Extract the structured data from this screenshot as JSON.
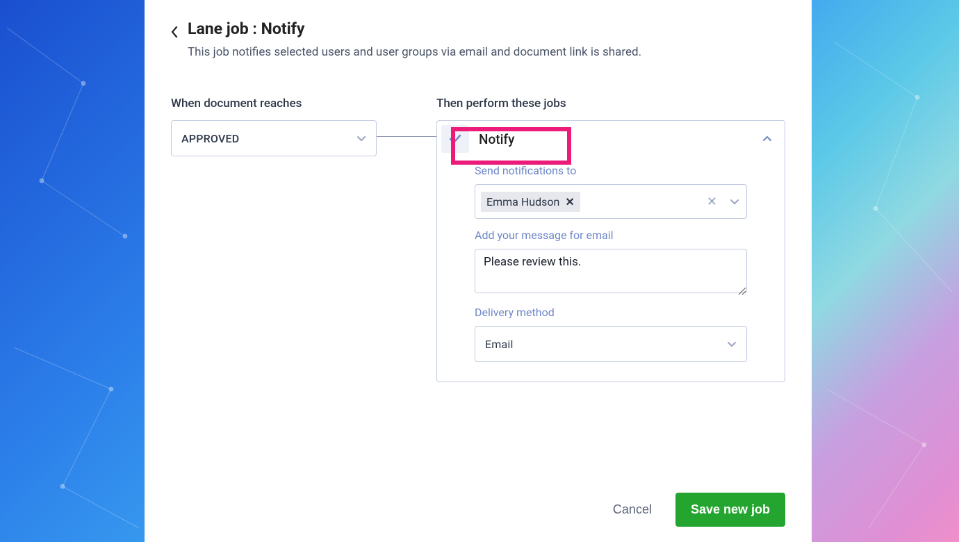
{
  "header": {
    "title": "Lane job : Notify",
    "subtitle": "This job notifies selected users and user groups via email and document link is shared."
  },
  "trigger": {
    "label": "When document reaches",
    "value": "APPROVED"
  },
  "jobs": {
    "label": "Then perform these jobs",
    "job_title": "Notify",
    "recipients_label": "Send notifications to",
    "recipient_chip": "Emma Hudson",
    "message_label": "Add your message for email",
    "message_value": "Please review this.",
    "delivery_label": "Delivery method",
    "delivery_value": "Email"
  },
  "footer": {
    "cancel": "Cancel",
    "save": "Save new job"
  }
}
